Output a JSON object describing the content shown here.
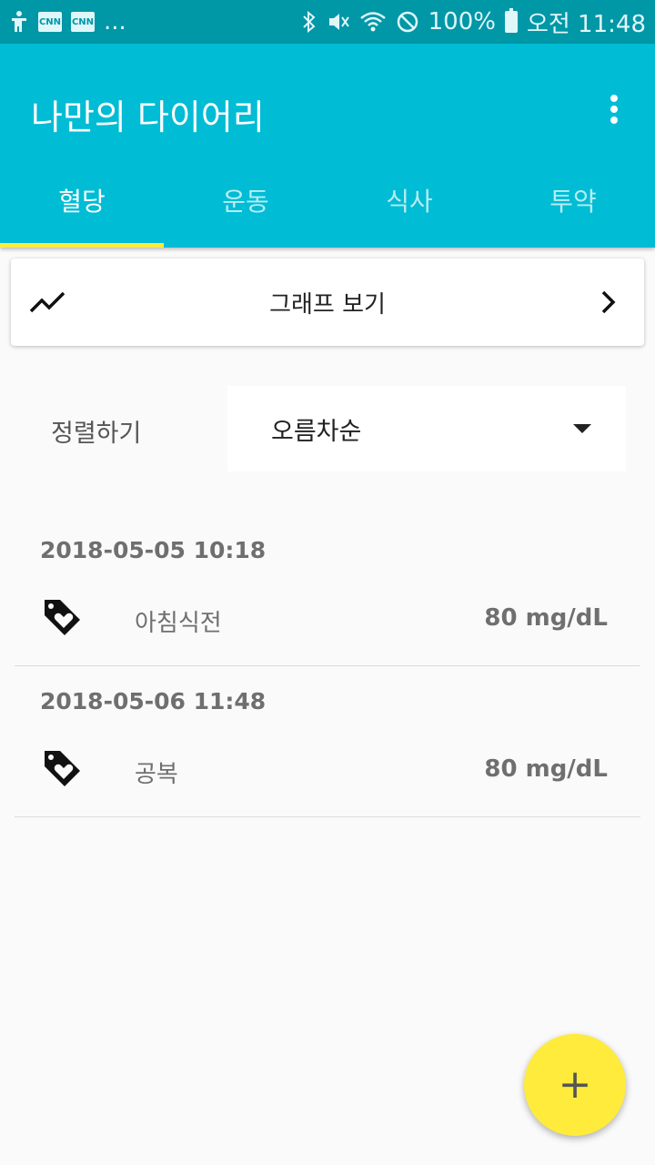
{
  "status_bar": {
    "notif_cnn_1": "CNN",
    "notif_cnn_2": "CNN",
    "more": "...",
    "battery": "100%",
    "time": "오전 11:48"
  },
  "app_bar": {
    "title": "나만의 다이어리"
  },
  "tabs": [
    {
      "label": "혈당",
      "active": true
    },
    {
      "label": "운동",
      "active": false
    },
    {
      "label": "식사",
      "active": false
    },
    {
      "label": "투약",
      "active": false
    }
  ],
  "graph_card": {
    "label": "그래프 보기",
    "icon": "trending-icon"
  },
  "sort": {
    "label": "정렬하기",
    "value": "오름차순"
  },
  "entries": [
    {
      "date": "2018-05-05 10:18",
      "meal": "아침식전",
      "value": "80 mg/dL",
      "icon": "heart-tag-icon"
    },
    {
      "date": "2018-05-06 11:48",
      "meal": "공복",
      "value": "80 mg/dL",
      "icon": "heart-tag-icon"
    }
  ],
  "fab": {
    "label": "+"
  },
  "colors": {
    "primary": "#00bcd4",
    "primary_dark": "#0097a7",
    "accent": "#ffeb3b"
  }
}
